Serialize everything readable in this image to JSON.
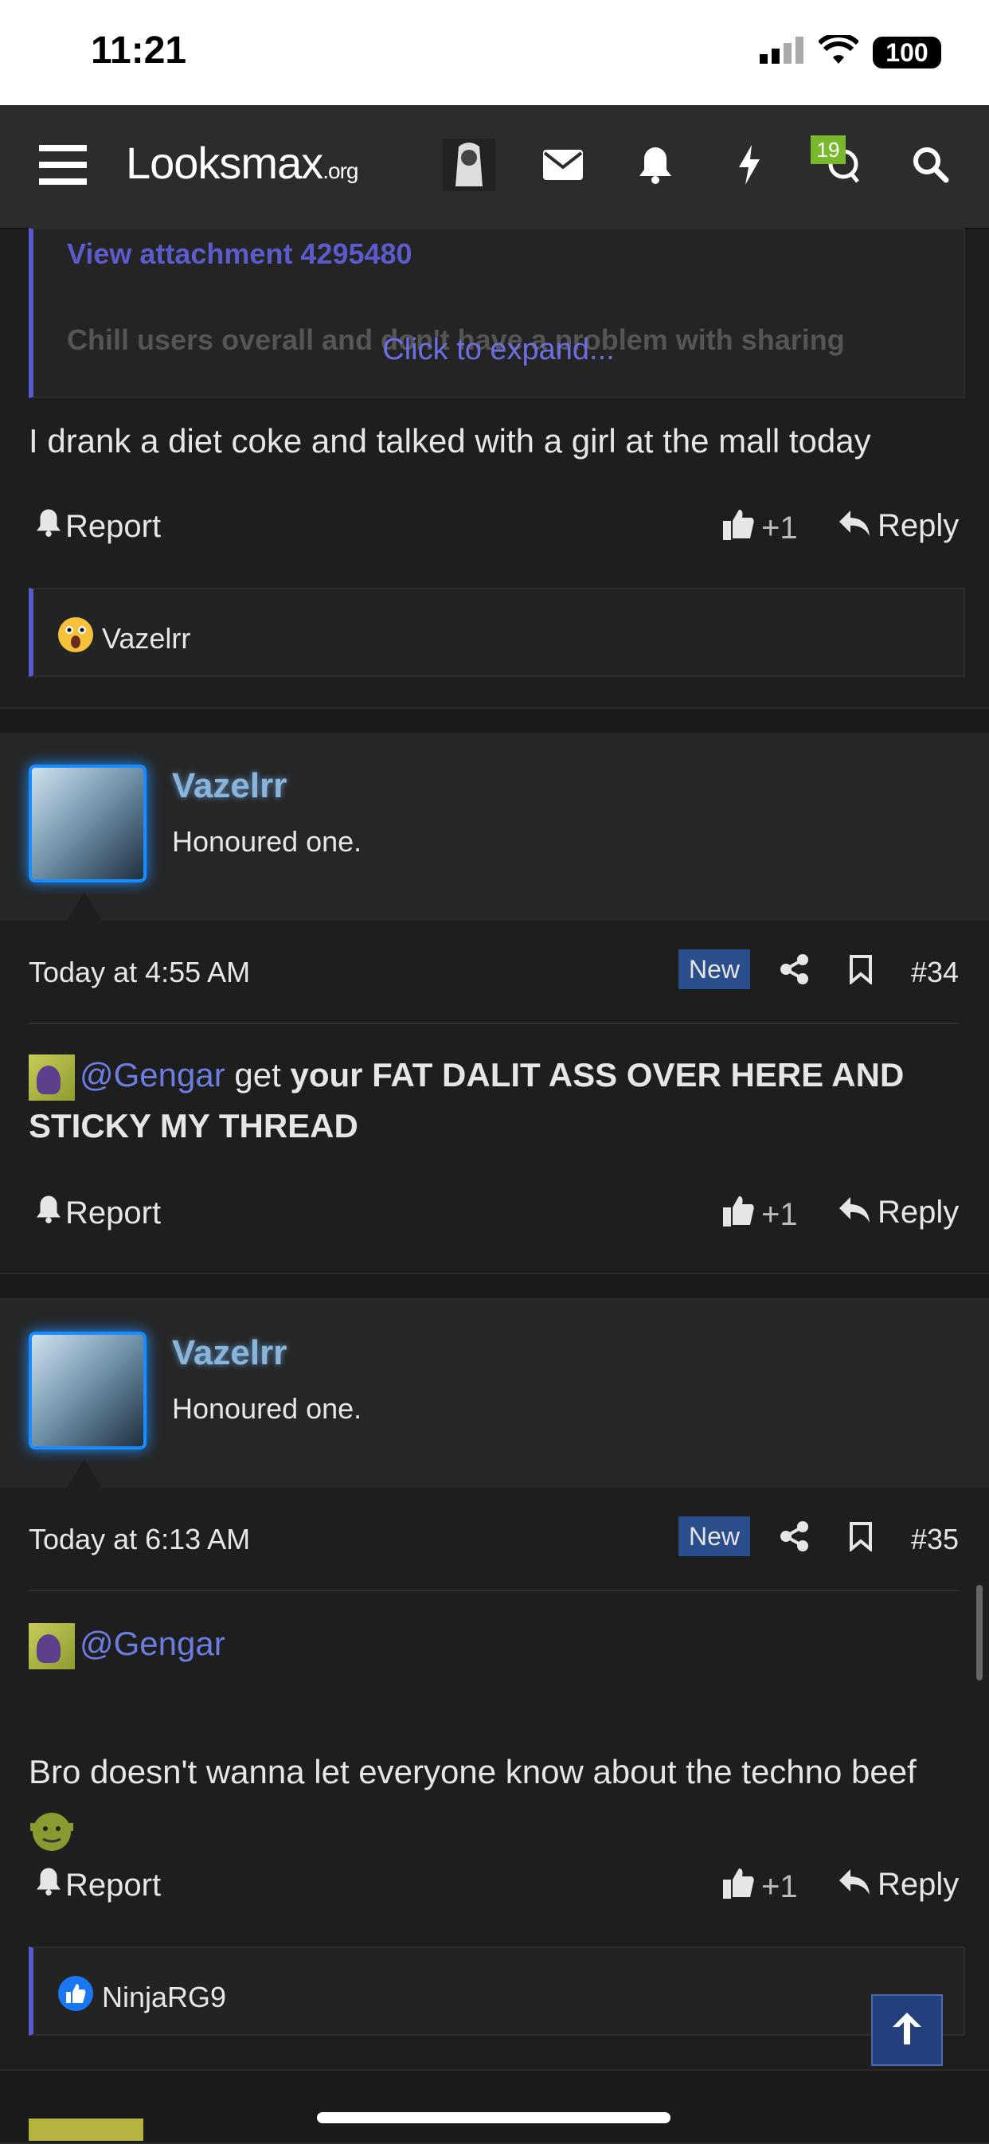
{
  "status": {
    "time": "11:21",
    "battery": "100"
  },
  "nav": {
    "logo_main": "Looksmax",
    "logo_suffix": ".org",
    "notification_badge": "19"
  },
  "quote": {
    "attachment_link": "View attachment 4295480",
    "text": "Chill users overall and don't have a problem with sharing",
    "expand": "Click to expand..."
  },
  "post1": {
    "text": "I drank a diet coke and talked with a girl at the mall today",
    "report": "Report",
    "like": "+1",
    "reply": "Reply",
    "reaction_user": "Vazelrr"
  },
  "post34": {
    "username": "Vazelrr",
    "title": "Honoured one.",
    "date": "Today at 4:55 AM",
    "new_label": "New",
    "number": "#34",
    "mention": "@Gengar",
    "text_plain": " get ",
    "text_bold": "your FAT DALIT ASS OVER HERE AND STICKY MY THREAD",
    "report": "Report",
    "like": "+1",
    "reply": "Reply"
  },
  "post35": {
    "username": "Vazelrr",
    "title": "Honoured one.",
    "date": "Today at 6:13 AM",
    "new_label": "New",
    "number": "#35",
    "mention": "@Gengar",
    "text": "Bro doesn't wanna let everyone know about the techno beef",
    "report": "Report",
    "like": "+1",
    "reply": "Reply",
    "reaction_user": "NinjaRG9"
  }
}
